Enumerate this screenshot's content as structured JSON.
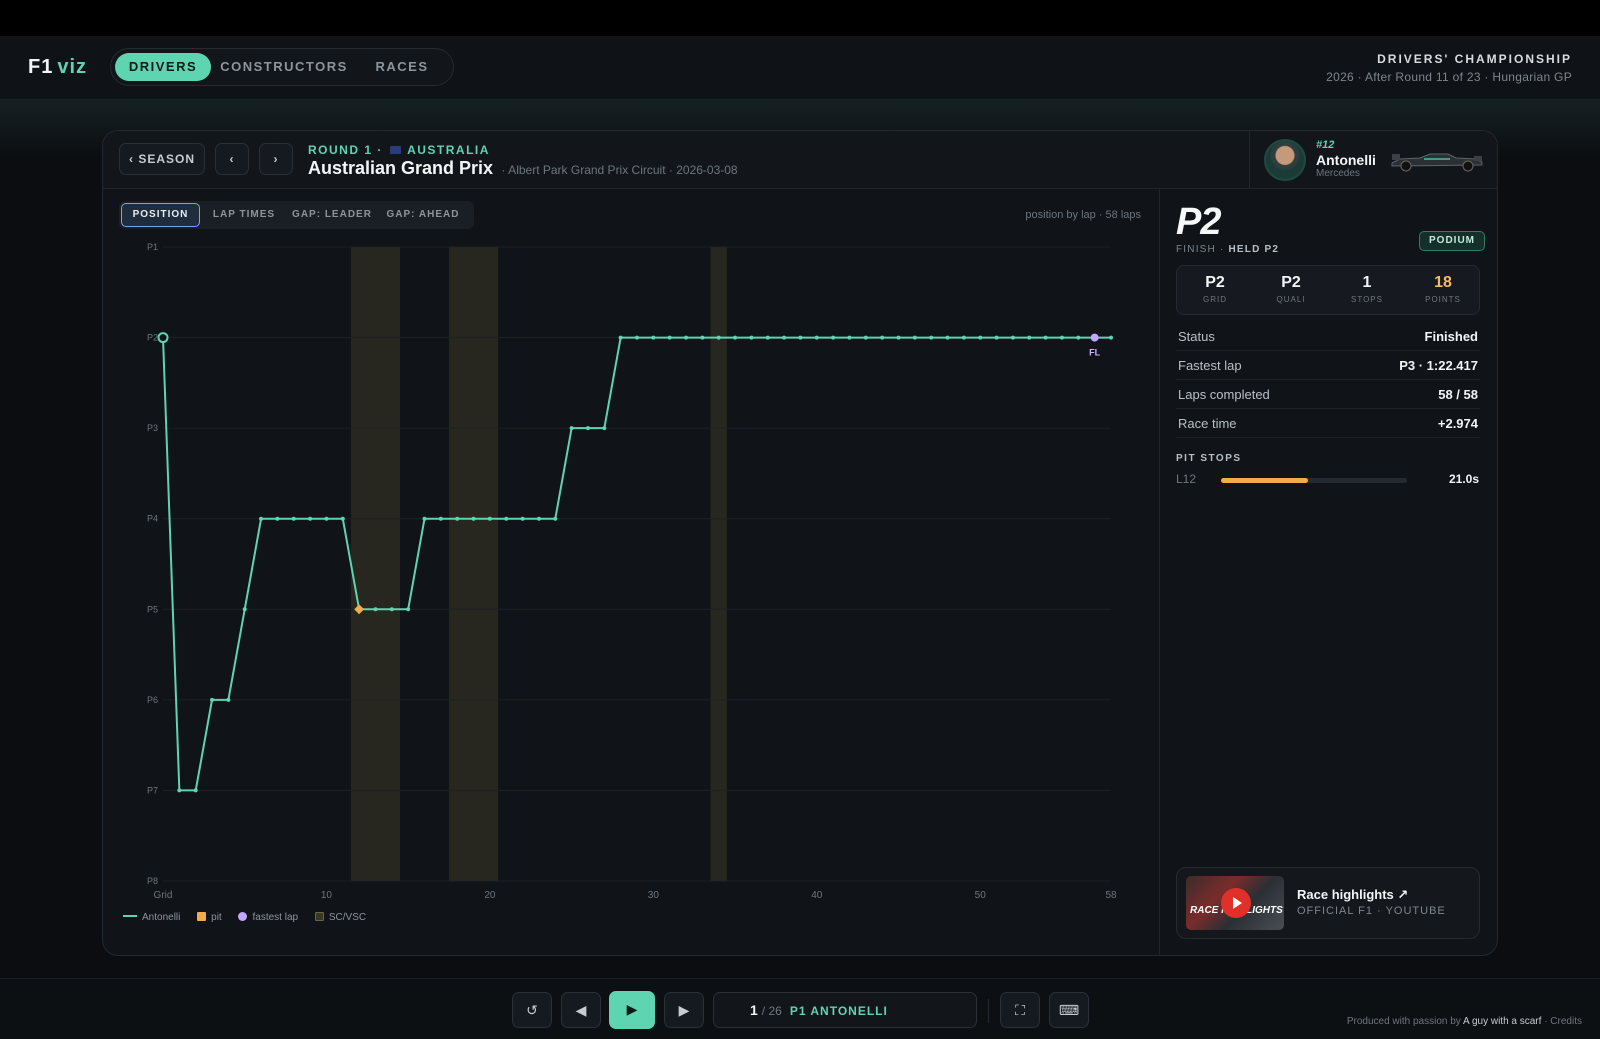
{
  "app": {
    "logo_f1": "F1",
    "logo_viz": "viz"
  },
  "nav": {
    "tabs": [
      "DRIVERS",
      "CONSTRUCTORS",
      "RACES"
    ],
    "active": "DRIVERS"
  },
  "championship": {
    "title": "DRIVERS' CHAMPIONSHIP",
    "subtitle": "2026 · After Round 11 of 23 · Hungarian GP"
  },
  "race": {
    "season_button": "‹ SEASON",
    "prev_button": "‹",
    "next_button": "›",
    "round_label": "ROUND 1 ·",
    "country": "AUSTRALIA",
    "name": "Australian Grand Prix",
    "meta": "· Albert Park Grand Prix Circuit · 2026-03-08"
  },
  "driver": {
    "number": "#12",
    "name": "Antonelli",
    "team": "Mercedes"
  },
  "chart_tabs": [
    "POSITION",
    "LAP TIMES",
    "GAP: LEADER",
    "GAP: AHEAD"
  ],
  "chart_note": "position by lap · 58 laps",
  "legend": {
    "driver": "Antonelli",
    "pit": "pit",
    "fastest": "fastest lap",
    "sc": "SC/VSC"
  },
  "colors": {
    "accent": "#5fd4b0",
    "pit": "#f0ad4e",
    "fastest": "#c3a6ff",
    "sc": "#3a3726"
  },
  "chart_data": {
    "type": "line",
    "x_label_start": "Grid",
    "x_ticks": [
      10,
      20,
      30,
      40,
      50,
      58
    ],
    "xlim": [
      0,
      58
    ],
    "y_labels": [
      "P1",
      "P2",
      "P3",
      "P4",
      "P5",
      "P6",
      "P7",
      "P8"
    ],
    "ylim": [
      1,
      8
    ],
    "inverted_y": true,
    "series": [
      {
        "name": "Antonelli",
        "x": [
          0,
          1,
          2,
          3,
          4,
          5,
          6,
          7,
          8,
          9,
          10,
          11,
          12,
          13,
          14,
          15,
          16,
          17,
          18,
          19,
          20,
          21,
          22,
          23,
          24,
          25,
          26,
          27,
          28,
          29,
          30,
          31,
          32,
          33,
          34,
          35,
          36,
          37,
          38,
          39,
          40,
          41,
          42,
          43,
          44,
          45,
          46,
          47,
          48,
          49,
          50,
          51,
          52,
          53,
          54,
          55,
          56,
          57,
          58
        ],
        "y": [
          2,
          7,
          7,
          6,
          6,
          5,
          4,
          4,
          4,
          4,
          4,
          4,
          5,
          5,
          5,
          5,
          4,
          4,
          4,
          4,
          4,
          4,
          4,
          4,
          4,
          3,
          3,
          3,
          2,
          2,
          2,
          2,
          2,
          2,
          2,
          2,
          2,
          2,
          2,
          2,
          2,
          2,
          2,
          2,
          2,
          2,
          2,
          2,
          2,
          2,
          2,
          2,
          2,
          2,
          2,
          2,
          2,
          2,
          2
        ]
      }
    ],
    "pit_laps": [
      12
    ],
    "fastest_lap": 57,
    "fastest_label": "FL",
    "sc_periods": [
      [
        11.5,
        14.5
      ],
      [
        17.5,
        20.5
      ],
      [
        33.5,
        34.5
      ]
    ]
  },
  "result": {
    "position": "P2",
    "finish_label": "FINISH ·",
    "finish_note": "HELD P2",
    "badge": "PODIUM",
    "stats": [
      {
        "value": "P2",
        "label": "GRID"
      },
      {
        "value": "P2",
        "label": "QUALI"
      },
      {
        "value": "1",
        "label": "STOPS"
      },
      {
        "value": "18",
        "label": "POINTS"
      }
    ],
    "rows": [
      {
        "key": "Status",
        "value": "Finished"
      },
      {
        "key": "Fastest lap",
        "value": "P3 · 1:22.417"
      },
      {
        "key": "Laps completed",
        "value": "58 / 58"
      },
      {
        "key": "Race time",
        "value": "+2.974"
      }
    ],
    "pit_title": "PIT STOPS",
    "pit_stops": [
      {
        "lap": "L12",
        "time": "21.0s",
        "fraction": 0.47
      }
    ]
  },
  "highlights": {
    "title": "Race highlights ↗",
    "subtitle": "OFFICIAL F1 · YOUTUBE",
    "thumb_text": "RACE HIGHLIGHTS"
  },
  "playback": {
    "current": "1",
    "total": "/ 26",
    "leader": "P1 ANTONELLI"
  },
  "credits": {
    "prefix": "Produced with passion by",
    "author": "A guy with a scarf",
    "suffix": "· Credits"
  }
}
